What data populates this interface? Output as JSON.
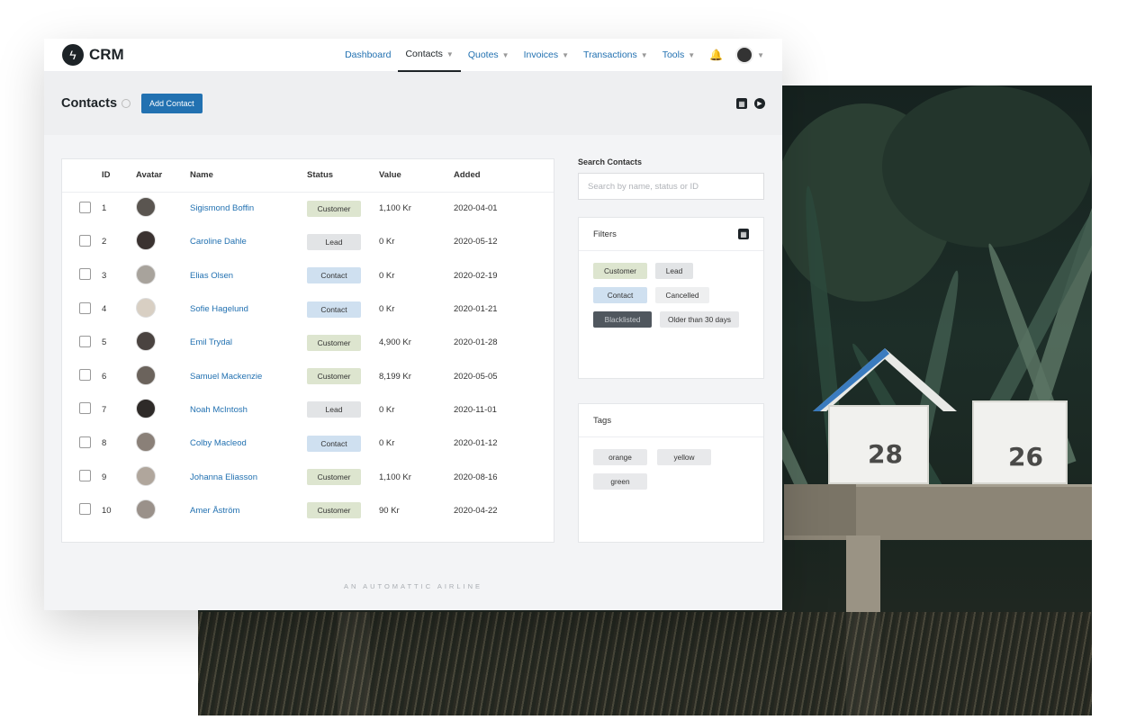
{
  "app": {
    "logo_text": "CRM"
  },
  "nav": {
    "items": [
      {
        "label": "Dashboard",
        "caret": false,
        "active": false
      },
      {
        "label": "Contacts",
        "caret": true,
        "active": true
      },
      {
        "label": "Quotes",
        "caret": true,
        "active": false
      },
      {
        "label": "Invoices",
        "caret": true,
        "active": false
      },
      {
        "label": "Transactions",
        "caret": true,
        "active": false
      },
      {
        "label": "Tools",
        "caret": true,
        "active": false
      }
    ]
  },
  "page": {
    "title": "Contacts",
    "add_button": "Add Contact"
  },
  "table": {
    "headers": [
      "ID",
      "Avatar",
      "Name",
      "Status",
      "Value",
      "Added"
    ],
    "rows": [
      {
        "id": "1",
        "name": "Sigismond Boffin",
        "status": "Customer",
        "value": "1,100 Kr",
        "added": "2020-04-01",
        "avatar_color": "#5a5550"
      },
      {
        "id": "2",
        "name": "Caroline Dahle",
        "status": "Lead",
        "value": "0 Kr",
        "added": "2020-05-12",
        "avatar_color": "#3a3230"
      },
      {
        "id": "3",
        "name": "Elias Olsen",
        "status": "Contact",
        "value": "0 Kr",
        "added": "2020-02-19",
        "avatar_color": "#a8a39c"
      },
      {
        "id": "4",
        "name": "Sofie Hagelund",
        "status": "Contact",
        "value": "0 Kr",
        "added": "2020-01-21",
        "avatar_color": "#d8cfc3"
      },
      {
        "id": "5",
        "name": "Emil Trydal",
        "status": "Customer",
        "value": "4,900 Kr",
        "added": "2020-01-28",
        "avatar_color": "#4a4340"
      },
      {
        "id": "6",
        "name": "Samuel Mackenzie",
        "status": "Customer",
        "value": "8,199 Kr",
        "added": "2020-05-05",
        "avatar_color": "#6b635c"
      },
      {
        "id": "7",
        "name": "Noah McIntosh",
        "status": "Lead",
        "value": "0 Kr",
        "added": "2020-11-01",
        "avatar_color": "#2e2a28"
      },
      {
        "id": "8",
        "name": "Colby Macleod",
        "status": "Contact",
        "value": "0 Kr",
        "added": "2020-01-12",
        "avatar_color": "#8a8078"
      },
      {
        "id": "9",
        "name": "Johanna Eliasson",
        "status": "Customer",
        "value": "1,100 Kr",
        "added": "2020-08-16",
        "avatar_color": "#b0a69c"
      },
      {
        "id": "10",
        "name": "Amer Åström",
        "status": "Customer",
        "value": "90 Kr",
        "added": "2020-04-22",
        "avatar_color": "#9a918a"
      }
    ]
  },
  "search": {
    "label": "Search Contacts",
    "placeholder": "Search by name, status or ID"
  },
  "filters": {
    "title": "Filters",
    "chips": [
      {
        "label": "Customer",
        "kind": "customer"
      },
      {
        "label": "Lead",
        "kind": "lead"
      },
      {
        "label": "Contact",
        "kind": "contact"
      },
      {
        "label": "Cancelled",
        "kind": "cancelled"
      },
      {
        "label": "Blacklisted",
        "kind": "black"
      },
      {
        "label": "Older than 30 days",
        "kind": "old"
      }
    ]
  },
  "tags": {
    "title": "Tags",
    "items": [
      "orange",
      "yellow",
      "green"
    ]
  },
  "footer": {
    "text": "AN AUTOMATTIC AIRLINE"
  },
  "photo": {
    "mailbox_left": "28",
    "mailbox_right": "26"
  }
}
